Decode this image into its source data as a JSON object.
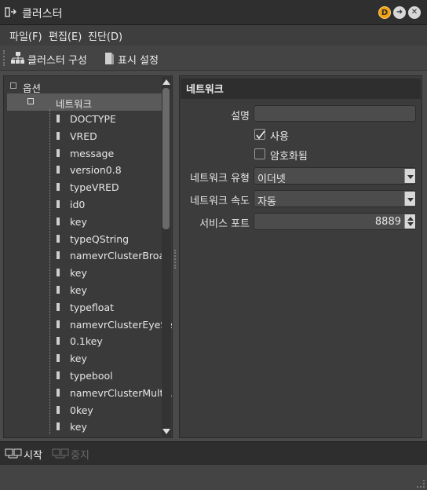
{
  "window": {
    "title": "클러스터"
  },
  "titlebar_buttons": {
    "d_label": "D"
  },
  "menu": [
    {
      "label": "파일(F)"
    },
    {
      "label": "편집(E)"
    },
    {
      "label": "진단(D)"
    }
  ],
  "toolbar": {
    "cluster_config": "클러스터 구성",
    "display_settings": "표시 설정"
  },
  "tree": {
    "root": "옵션",
    "selected": "네트워크",
    "items": [
      "DOCTYPE",
      "VRED",
      "message",
      "version0.8",
      "typeVRED",
      "id0",
      "key",
      "typeQString",
      "namevrClusterBroad...",
      "key",
      "key",
      "typefloat",
      "namevrClusterEyeSe...",
      "0.1key",
      "key",
      "typebool",
      "namevrClusterMulti...",
      "0key",
      "key"
    ]
  },
  "properties": {
    "header": "네트워크",
    "description_label": "설명",
    "description_value": "",
    "use_label": "사용",
    "use_checked": true,
    "encrypt_label": "암호화됨",
    "encrypt_checked": false,
    "net_type_label": "네트워크 유형",
    "net_type_value": "이더넷",
    "net_speed_label": "네트워크 속도",
    "net_speed_value": "자동",
    "service_port_label": "서비스 포트",
    "service_port_value": "8889"
  },
  "status": {
    "start_label": "시작",
    "stop_label": "중지"
  },
  "colors": {
    "accent": "#f0a010",
    "panel": "#3c3c3c",
    "selected": "#5a5a5a"
  }
}
